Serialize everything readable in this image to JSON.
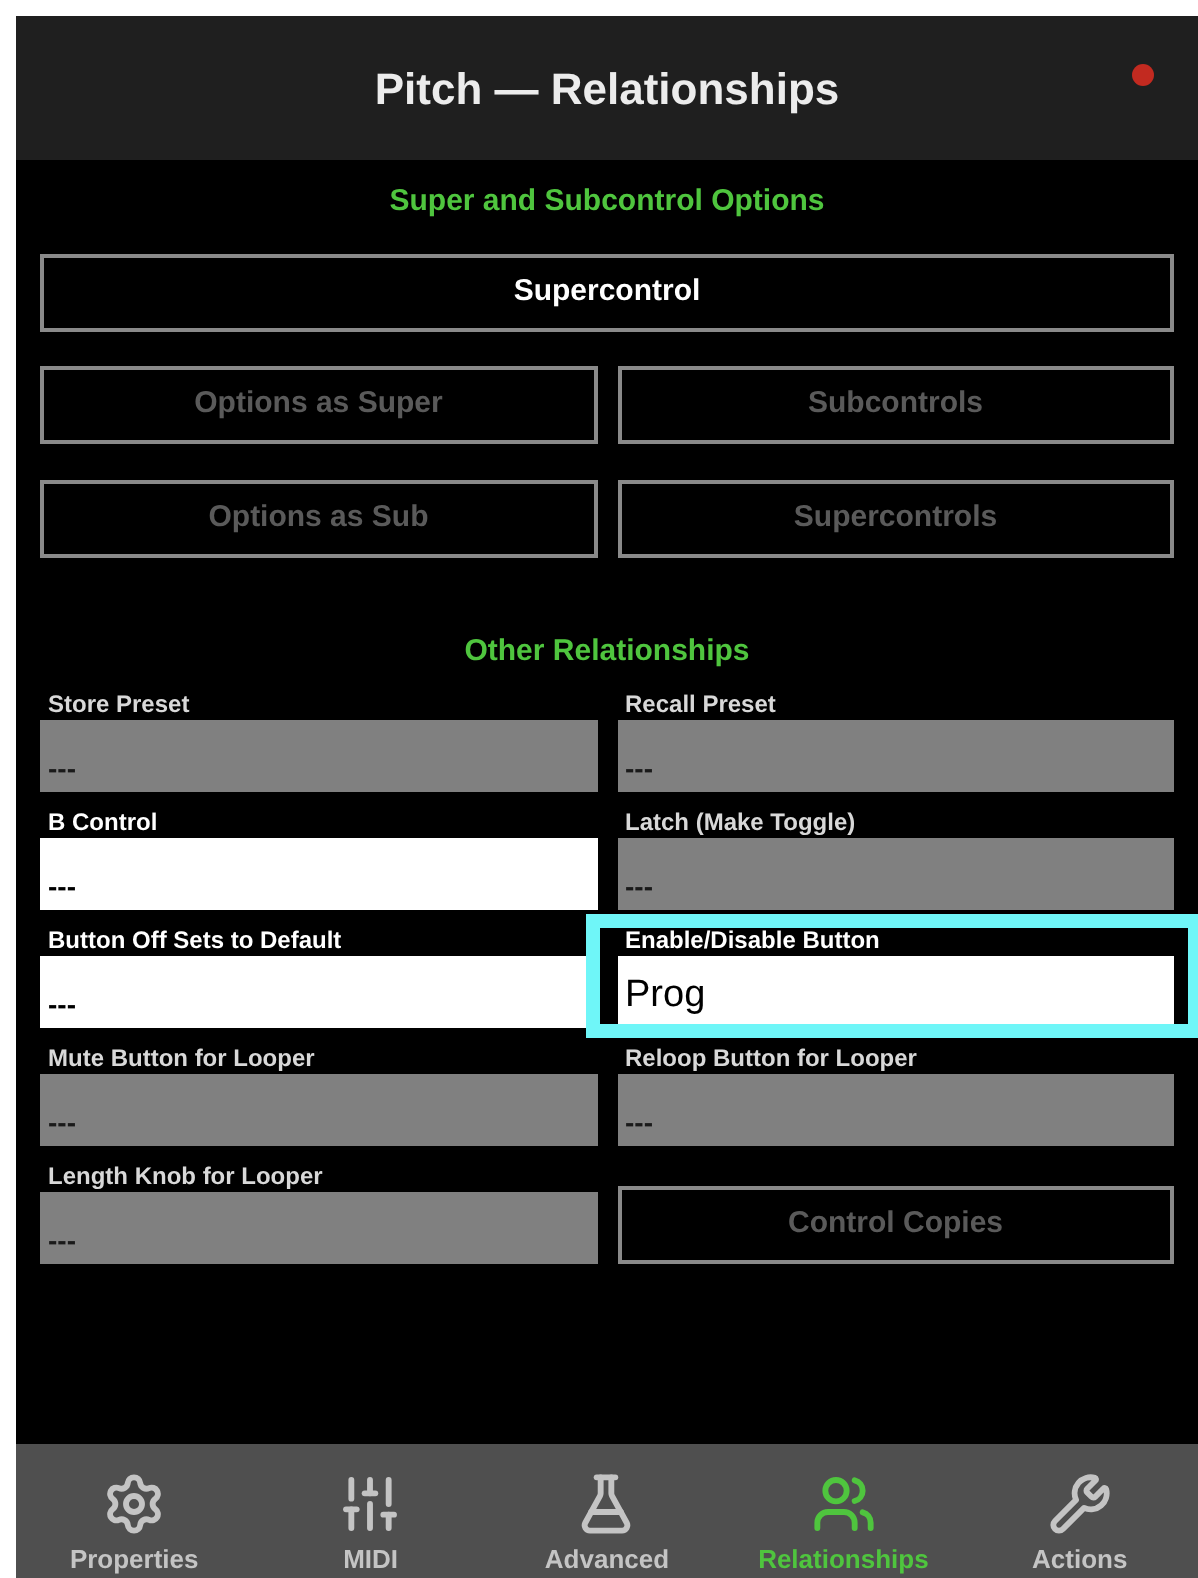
{
  "window": {
    "title": "Pitch — Relationships",
    "record_dot": true
  },
  "super_section": {
    "heading": "Super and Subcontrol Options",
    "buttons": [
      {
        "label": "Supercontrol",
        "disabled": false
      },
      {
        "label": "Options as Super",
        "disabled": true
      },
      {
        "label": "Subcontrols",
        "disabled": true
      },
      {
        "label": "Options as Sub",
        "disabled": true
      },
      {
        "label": "Supercontrols",
        "disabled": true
      }
    ]
  },
  "other_section": {
    "heading": "Other Relationships",
    "items": [
      {
        "kind": "field",
        "label": "Store Preset",
        "value": "---",
        "disabled": true,
        "highlighted": false
      },
      {
        "kind": "field",
        "label": "Recall Preset",
        "value": "---",
        "disabled": true,
        "highlighted": false
      },
      {
        "kind": "field",
        "label": "B Control",
        "value": "---",
        "disabled": false,
        "highlighted": false
      },
      {
        "kind": "field",
        "label": "Latch (Make Toggle)",
        "value": "---",
        "disabled": true,
        "highlighted": false
      },
      {
        "kind": "field",
        "label": "Button Off Sets to Default",
        "value": "---",
        "disabled": false,
        "highlighted": false
      },
      {
        "kind": "field",
        "label": "Enable/Disable Button",
        "value": "Prog",
        "disabled": false,
        "highlighted": true
      },
      {
        "kind": "field",
        "label": "Mute Button for Looper",
        "value": "---",
        "disabled": true,
        "highlighted": false
      },
      {
        "kind": "field",
        "label": "Reloop Button for Looper",
        "value": "---",
        "disabled": true,
        "highlighted": false
      },
      {
        "kind": "field",
        "label": "Length Knob for Looper",
        "value": "---",
        "disabled": true,
        "highlighted": false
      },
      {
        "kind": "button",
        "label": "Control Copies",
        "disabled": true
      }
    ]
  },
  "tab_bar": [
    {
      "label": "Properties",
      "selected": false
    },
    {
      "label": "MIDI",
      "selected": false
    },
    {
      "label": "Advanced",
      "selected": false
    },
    {
      "label": "Relationships",
      "selected": true
    },
    {
      "label": "Actions",
      "selected": false
    }
  ]
}
